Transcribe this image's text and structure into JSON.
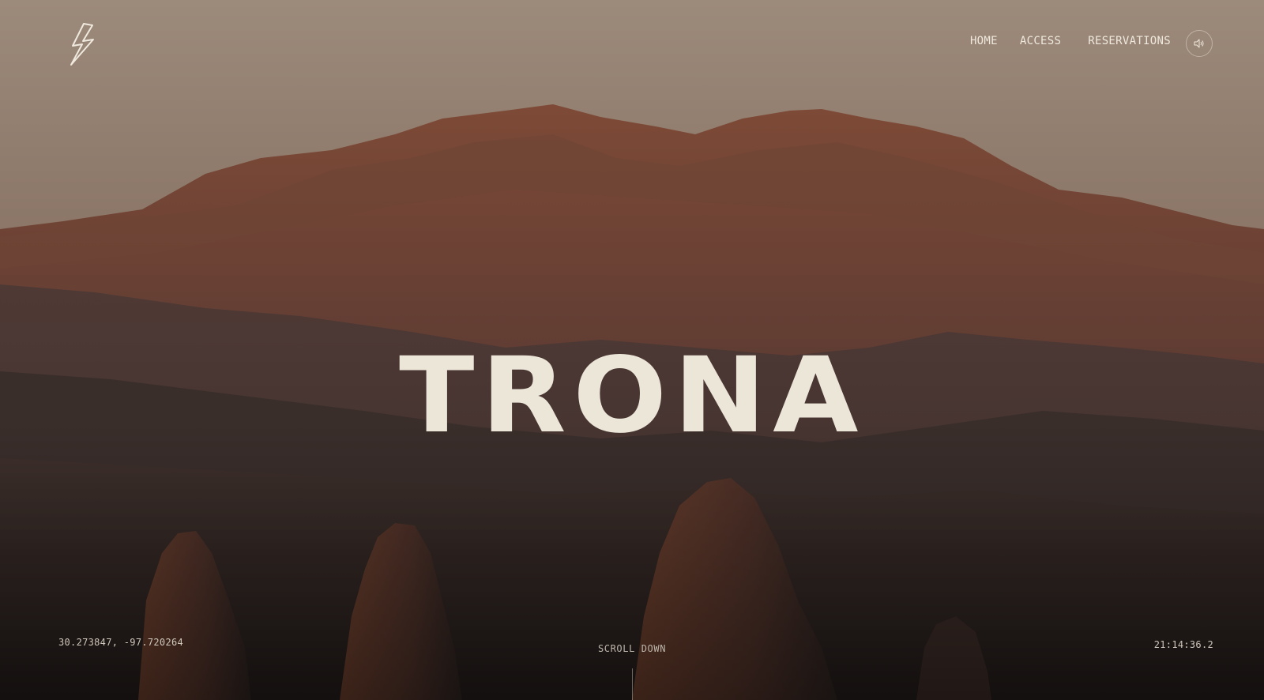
{
  "nav": {
    "items": [
      {
        "label": "HOME"
      },
      {
        "label": "ACCESS"
      },
      {
        "label": "RESERVATIONS"
      }
    ],
    "sound_icon": "speaker-icon"
  },
  "logo_icon": "lightning-bolt-icon",
  "hero": {
    "title": "TRONA"
  },
  "footer": {
    "coordinates": "30.273847, -97.720264",
    "scroll_label": "SCROLL DOWN",
    "time": "21:14:36.2"
  },
  "colors": {
    "text": "#ece6d9",
    "sky_top": "#9a8778",
    "sky_bottom": "#7a6658",
    "mountain_far": "#6b3f30",
    "mountain_shadow": "#3a2e2d",
    "ground_dark": "#2a221f"
  }
}
